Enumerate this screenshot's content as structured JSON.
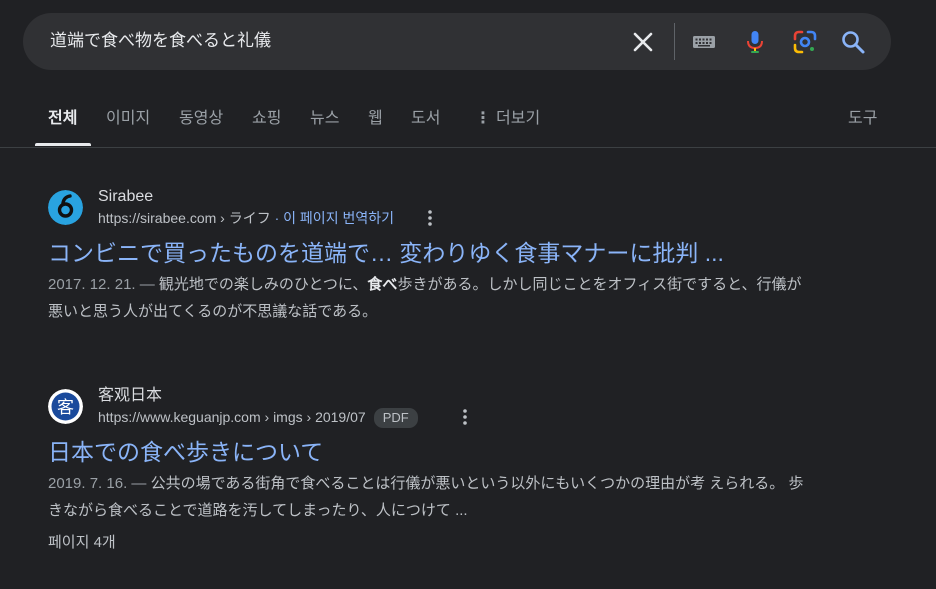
{
  "search": {
    "query": "道端で食べ物を食べると礼儀"
  },
  "tabs": [
    {
      "label": "전체"
    },
    {
      "label": "이미지"
    },
    {
      "label": "동영상"
    },
    {
      "label": "쇼핑"
    },
    {
      "label": "뉴스"
    },
    {
      "label": "웹"
    },
    {
      "label": "도서"
    },
    {
      "label": "더보기"
    },
    {
      "label": "도구"
    }
  ],
  "results": [
    {
      "site_name": "Sirabee",
      "url": "https://sirabee.com › ライフ",
      "translate": "· 이 페이지 번역하기",
      "title": "コンビニで買ったものを道端で… 変わりゆく食事マナーに批判 ...",
      "date": "2017. 12. 21. —",
      "snippet_a": " 観光地での楽しみのひとつに、",
      "snippet_bold": "食べ",
      "snippet_b": "歩きがある。しかし同じことをオフィス街ですると、行儀が悪いと思う人が出てくるのが不思議な話である。"
    },
    {
      "site_name": "客观日本",
      "url": "https://www.keguanjp.com › imgs › 2019/07",
      "badge": "PDF",
      "title": "日本での食べ歩きについて",
      "date": "2019. 7. 16. —",
      "snippet": " 公共の場である街角で食べることは行儀が悪いという以外にもいくつかの理由が考 えられる。 歩きながら食べることで道路を汚してしまったり、人につけて ...",
      "extra": "페이지 4개"
    }
  ],
  "colors": {
    "background": "#202124",
    "search_bar": "#303134",
    "link": "#8ab4f8",
    "text": "#bdc1c6"
  },
  "icons": {
    "clear": "close-icon",
    "keyboard": "keyboard-icon",
    "mic": "mic-icon",
    "lens": "google-lens-icon",
    "search": "search-icon",
    "more": "vertical-dots-icon"
  }
}
